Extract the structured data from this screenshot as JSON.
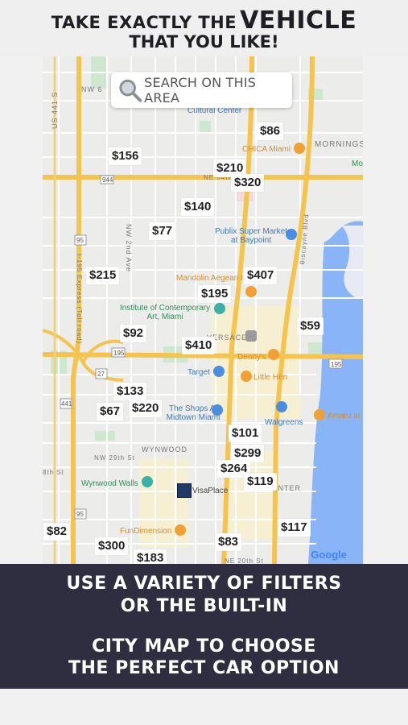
{
  "header": {
    "line1_prefix": "TAKE EXACTLY THE",
    "line1_emphasis": "VEHICLE",
    "line2": "THAT YOU LIKE!"
  },
  "search": {
    "label": "SEARCH ON THIS AREA"
  },
  "prices": [
    "$86",
    "$156",
    "$210",
    "$320",
    "$140",
    "$77",
    "$215",
    "$407",
    "$195",
    "$59",
    "$92",
    "$410",
    "$133",
    "$220",
    "$67",
    "$101",
    "$299",
    "$264",
    "$119",
    "$82",
    "$117",
    "$300",
    "$83",
    "$183"
  ],
  "map_labels": {
    "chica": "CHICA Miami",
    "mornings": "MORNINGS",
    "mo": "Mo",
    "ne54": "NE 54th",
    "publix": "Publix Super Market at Baypoint",
    "mandolin": "Mandolin Aegean I",
    "institute": "Institute of Contemporary Art, Miami",
    "versace": "VERSACE",
    "dennys": "Denny's",
    "target": "Target",
    "littlehen": "Little Hen",
    "shops": "The Shops At Midtown Miami",
    "walgreens": "Walgreens",
    "amaru": "Amaru at",
    "wynwood": "WYNWOOD",
    "nw29": "NW 29th St",
    "wynwoodwalls": "Wynwood Walls",
    "visaplace": "VisaPlace",
    "center": "CENTER",
    "fundimension": "FunDimension",
    "cultural": "Cultural Center",
    "biscayne": "Biscayne Blvd",
    "i195": "I-195 Express (Toll road)",
    "ne20": "NE 20th St",
    "nw2nd": "NW 2nd Ave",
    "us441": "US 441 S",
    "nw6": "NW 6",
    "sth": "8th St",
    "google": "Google",
    "r944": "944",
    "r95a": "95",
    "r95b": "95",
    "r195a": "195",
    "r195b": "195",
    "r27": "27",
    "r441": "441",
    "r195c": "195"
  },
  "footer": {
    "line1": "USE A VARIETY OF FILTERS",
    "line2": "OR THE BUILT-IN",
    "line3": "CITY MAP TO CHOOSE",
    "line4": "THE PERFECT CAR OPTION"
  },
  "colors": {
    "highway": "#f4c44e",
    "road": "#ffffff",
    "water": "#8ab4f8",
    "panel": "#2f2e40"
  }
}
